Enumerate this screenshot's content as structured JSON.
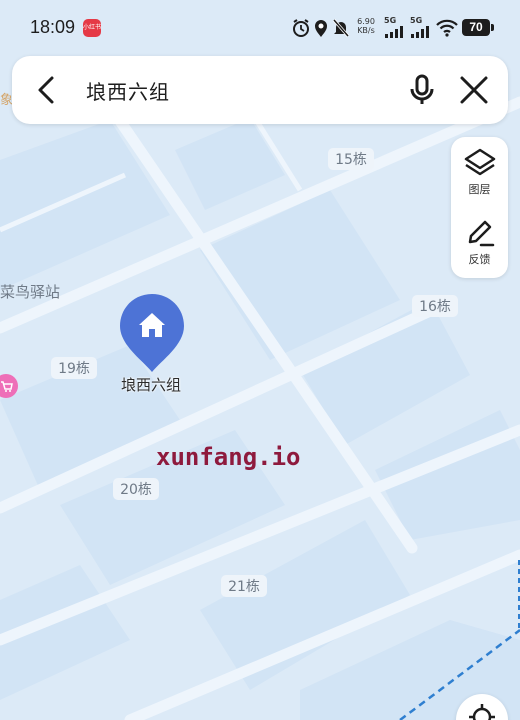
{
  "status_bar": {
    "time": "18:09",
    "app_badge": "小红书",
    "net_speed_value": "6.90",
    "net_speed_unit": "KB/s",
    "signal1_label": "5G",
    "signal2_label": "5G",
    "battery": "70"
  },
  "search": {
    "query": "埌西六组"
  },
  "tools": {
    "layers_label": "图层",
    "feedback_label": "反馈"
  },
  "map": {
    "buildings": [
      "15栋",
      "16栋",
      "19栋",
      "20栋",
      "21栋"
    ],
    "poi_label": "菜鸟驿站",
    "pin_label": "埌西六组",
    "corner_text": "象"
  },
  "watermark": "xunfang.io",
  "colors": {
    "map_bg": "#dceaf7",
    "block": "#d2e4f5",
    "road": "#eef5fc",
    "pin": "#4d73d6",
    "pink_poi": "#ee6fb8",
    "boundary": "#2f7fd0",
    "watermark": "#8e1a3d"
  },
  "icons": [
    "back-arrow-icon",
    "microphone-icon",
    "close-icon",
    "layers-icon",
    "feedback-pen-icon",
    "house-icon",
    "locate-icon"
  ]
}
